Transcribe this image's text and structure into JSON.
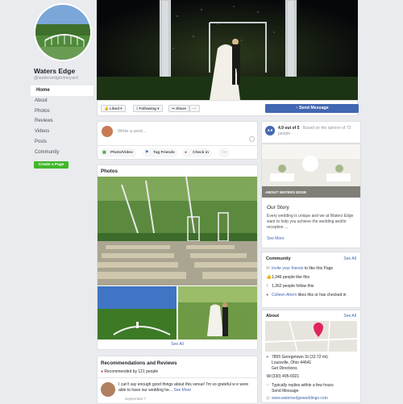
{
  "page": {
    "name": "Waters Edge",
    "handle": "@watersedgevineyard"
  },
  "nav": {
    "items": [
      "Home",
      "About",
      "Photos",
      "Reviews",
      "Videos",
      "Posts",
      "Community"
    ],
    "create_page": "Create a Page"
  },
  "actions": {
    "liked": "Liked ▾",
    "following": "Following ▾",
    "share": "Share",
    "more": "···",
    "send_message": "Send Message"
  },
  "composer": {
    "placeholder": "Write a post...",
    "photo_video": "Photo/Video",
    "tag_friends": "Tag Friends",
    "check_in": "Check in",
    "more": "···"
  },
  "photos": {
    "title": "Photos",
    "see_all": "See All"
  },
  "recommendations": {
    "title": "Recommendations and Reviews",
    "recommended_by": "Recommended by 121 people",
    "review_text": "I can't say enough good things about this venue! I'm so grateful w e were able to have our wedding he...",
    "see_more": "See More",
    "review_date": "September 7"
  },
  "rating": {
    "score": "4.9",
    "text": "4.9 out of 5",
    "basis": " · Based on the opinion of 72 people"
  },
  "ad": {
    "caption": "ABOUT WATERS EDGE",
    "story_title": "Our Story",
    "story_text": "Every wedding is unique and we at Waters Edge want to help you achieve the wedding and/or reception ...",
    "see_more": "See More"
  },
  "community": {
    "title": "Community",
    "see_all": "See All",
    "invite": "Invite your friends",
    "invite_suffix": " to like this Page",
    "likes": "1,346 people like this",
    "follows": "1,362 people follow this",
    "friend_name": "Colleen Ahern",
    "friend_suffix": " likes this or has checked in"
  },
  "about": {
    "title": "About",
    "see_all": "See All",
    "address_line1": "7805 Georgetown St (32.72 mi)",
    "address_line2": "Louisville, Ohio 44641",
    "directions": "Get Directions",
    "phone": "(330) 495-6921",
    "response": "Typically replies within a few hours",
    "send_message": "Send Message",
    "website": "www.watersedgeweddings.com"
  },
  "colors": {
    "brand_blue": "#4267b2",
    "green": "#42b72a",
    "background": "#e9ebee",
    "rating_badge": "#4267b2"
  }
}
